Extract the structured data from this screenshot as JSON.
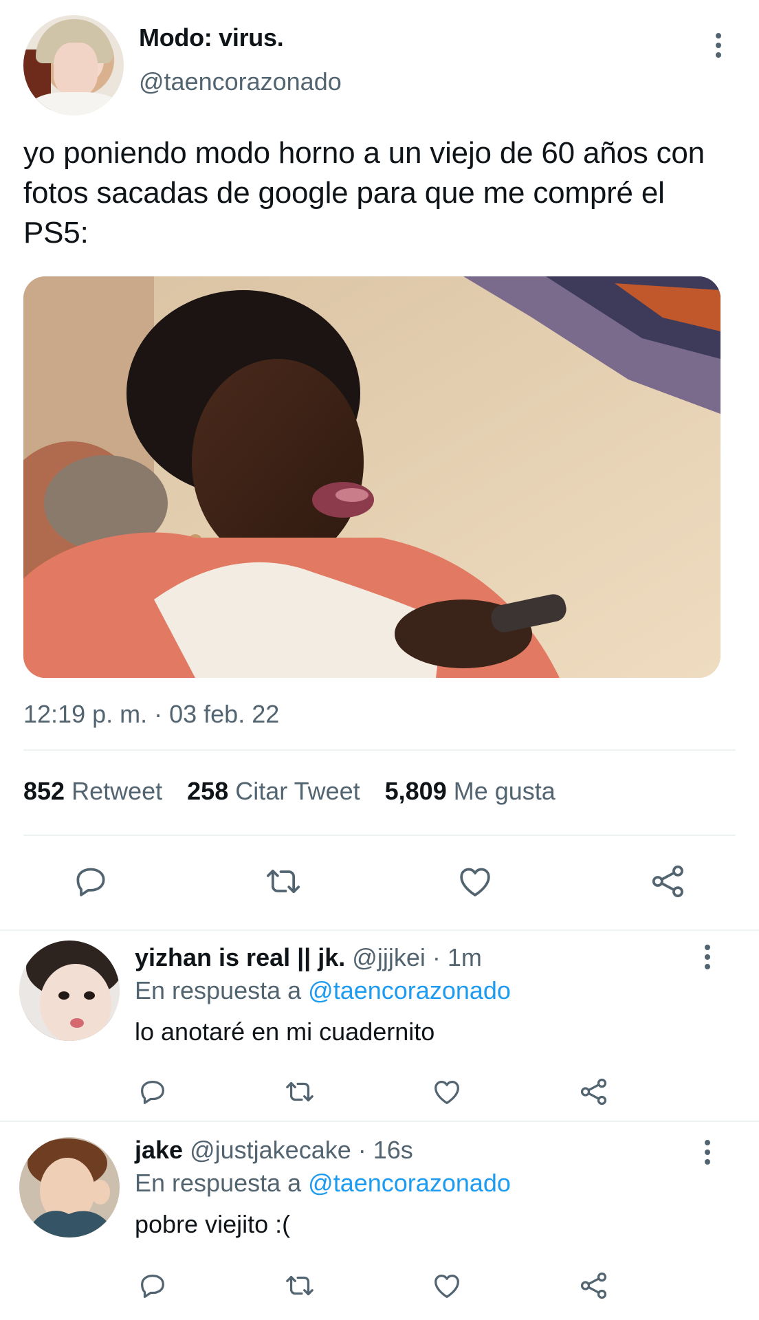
{
  "tweet": {
    "display_name": "Modo: virus.",
    "handle": "@taencorazonado",
    "text": "yo poniendo modo horno a un viejo de 60 años con fotos sacadas de google para que me compré el PS5:",
    "timestamp": "12:19 p. m. · 03 feb. 22",
    "stats": {
      "retweets_count": "852",
      "retweets_label": "Retweet",
      "quotes_count": "258",
      "quotes_label": "Citar Tweet",
      "likes_count": "5,809",
      "likes_label": "Me gusta"
    },
    "actions": [
      "reply-icon",
      "retweet-icon",
      "like-icon",
      "share-icon"
    ]
  },
  "replies": [
    {
      "display_name": "yizhan is real || jk.",
      "handle_time": "@jjjkei · 1m",
      "in_reply_prefix": "En respuesta a",
      "in_reply_mention": "@taencorazonado",
      "text": "lo anotaré en mi cuadernito"
    },
    {
      "display_name": "jake",
      "handle_time": "@justjakecake · 16s",
      "in_reply_prefix": "En respuesta a",
      "in_reply_mention": "@taencorazonado",
      "text": "pobre viejito :("
    }
  ],
  "colors": {
    "text": "#0f1419",
    "secondary": "#536471",
    "link": "#1d9bf0",
    "divider": "#eff3f4"
  }
}
